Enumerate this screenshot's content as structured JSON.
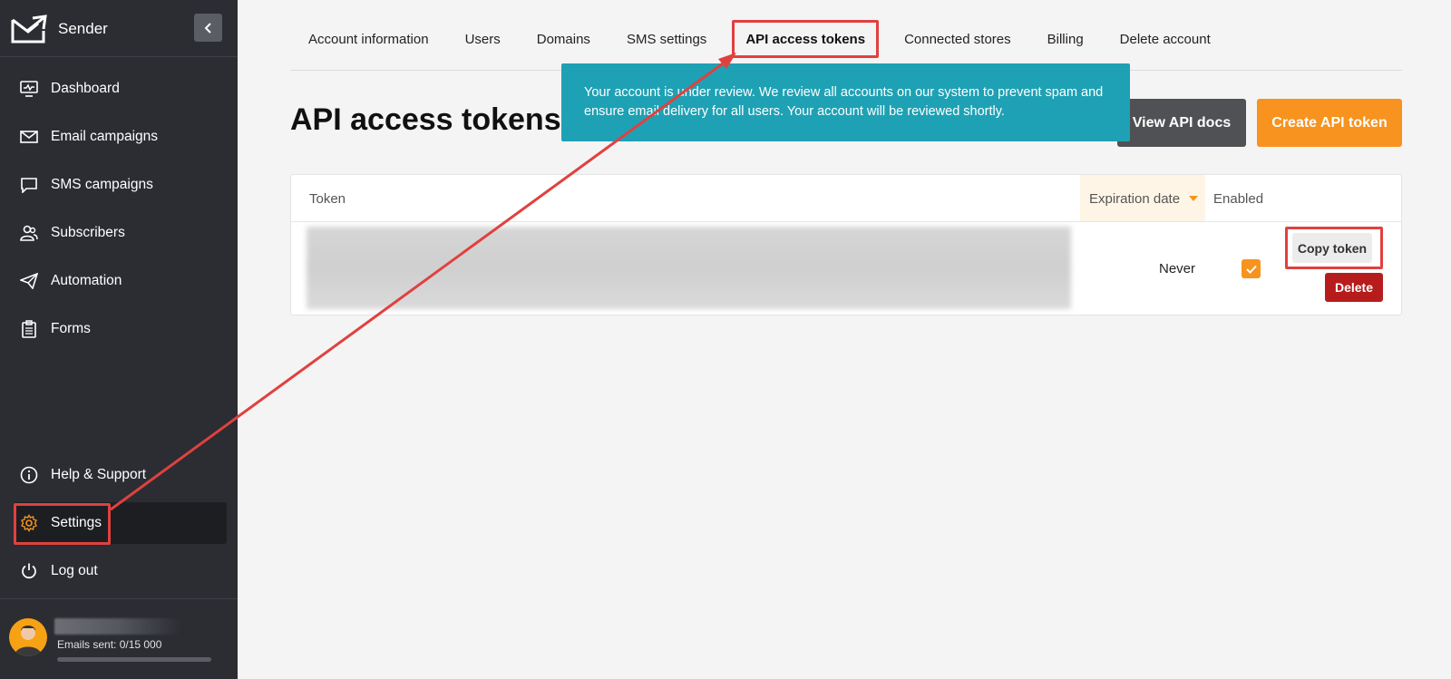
{
  "sidebar": {
    "brand": "Sender",
    "items": [
      {
        "label": "Dashboard",
        "icon": "dashboard-icon"
      },
      {
        "label": "Email campaigns",
        "icon": "envelope-icon"
      },
      {
        "label": "SMS campaigns",
        "icon": "chat-icon"
      },
      {
        "label": "Subscribers",
        "icon": "users-icon"
      },
      {
        "label": "Automation",
        "icon": "paper-plane-icon"
      },
      {
        "label": "Forms",
        "icon": "clipboard-icon"
      }
    ],
    "bottom_items": [
      {
        "label": "Help & Support",
        "icon": "info-icon"
      },
      {
        "label": "Settings",
        "icon": "gear-icon"
      },
      {
        "label": "Log out",
        "icon": "power-icon"
      }
    ],
    "emails_sent": "Emails sent: 0/15 000",
    "emails_progress": 0
  },
  "tabs": [
    "Account information",
    "Users",
    "Domains",
    "SMS settings",
    "API access tokens",
    "Connected stores",
    "Billing",
    "Delete account"
  ],
  "active_tab": "API access tokens",
  "page": {
    "title": "API access tokens",
    "view_docs_label": "View API docs",
    "create_label": "Create API token"
  },
  "banner": {
    "text": "Your account is under review. We review all accounts on our system to prevent spam and ensure email delivery for all users. Your account will be reviewed shortly."
  },
  "table": {
    "headers": {
      "token": "Token",
      "expiration": "Expiration date",
      "enabled": "Enabled"
    },
    "rows": [
      {
        "expiration": "Never",
        "enabled": true,
        "copy_label": "Copy token",
        "delete_label": "Delete"
      }
    ]
  },
  "colors": {
    "sidebar_bg": "#2b2d33",
    "accent_orange": "#f7931e",
    "banner_teal": "#1ea1b4",
    "annotation_red": "#e0413f",
    "delete_red": "#b71c1c"
  }
}
